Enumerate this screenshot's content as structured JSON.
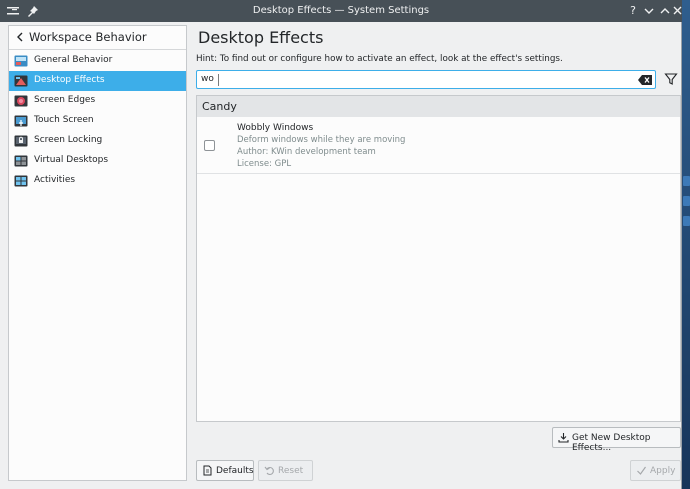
{
  "window": {
    "title": "Desktop Effects — System Settings",
    "controls": [
      "?",
      "minimize",
      "maximize",
      "close"
    ]
  },
  "sidebar": {
    "title": "Workspace Behavior",
    "items": [
      {
        "label": "General Behavior",
        "icon": "general-behavior-icon",
        "active": false
      },
      {
        "label": "Desktop Effects",
        "icon": "desktop-effects-icon",
        "active": true
      },
      {
        "label": "Screen Edges",
        "icon": "screen-edges-icon",
        "active": false
      },
      {
        "label": "Touch Screen",
        "icon": "touch-screen-icon",
        "active": false
      },
      {
        "label": "Screen Locking",
        "icon": "screen-locking-icon",
        "active": false
      },
      {
        "label": "Virtual Desktops",
        "icon": "virtual-desktops-icon",
        "active": false
      },
      {
        "label": "Activities",
        "icon": "activities-icon",
        "active": false
      }
    ]
  },
  "main": {
    "title": "Desktop Effects",
    "hint": "Hint: To find out or configure how to activate an effect, look at the effect's settings.",
    "search": {
      "value": "wo"
    },
    "categories": [
      {
        "name": "Candy",
        "effects": [
          {
            "name": "Wobbly Windows",
            "description": "Deform windows while they are moving",
            "author": "Author: KWin development team",
            "license": "License: GPL",
            "checked": false
          }
        ]
      }
    ],
    "get_new_label": "Get New Desktop Effects...",
    "defaults_label": "Defaults",
    "reset_label": "Reset",
    "apply_label": "Apply"
  },
  "colors": {
    "accent": "#3daee9",
    "titlebar": "#475057",
    "window_bg": "#eff0f1"
  }
}
